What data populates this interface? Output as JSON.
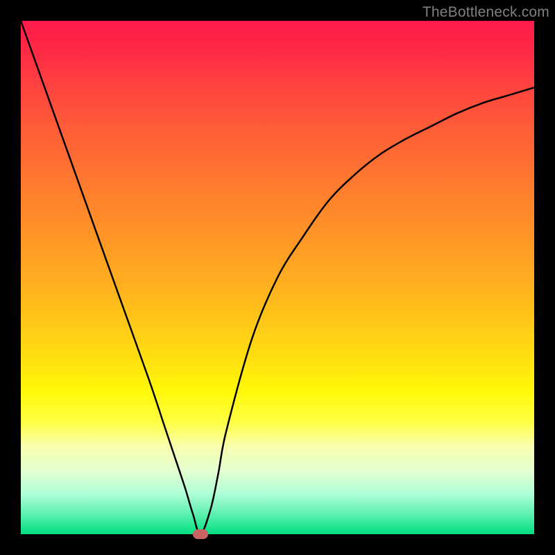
{
  "watermark": "TheBottleneck.com",
  "chart_data": {
    "type": "line",
    "title": "",
    "xlabel": "",
    "ylabel": "",
    "xlim": [
      0,
      100
    ],
    "ylim": [
      0,
      100
    ],
    "series": [
      {
        "name": "curve",
        "x": [
          0,
          5,
          10,
          15,
          20,
          25,
          28,
          30,
          32,
          33.5,
          35,
          37,
          38.5,
          40,
          45,
          50,
          55,
          60,
          65,
          70,
          75,
          80,
          85,
          90,
          95,
          100
        ],
        "y": [
          100,
          86,
          72,
          58,
          44,
          30,
          21,
          15,
          9,
          4,
          0,
          5,
          12,
          20,
          38,
          50,
          58,
          65,
          70,
          74,
          77,
          79.5,
          82,
          84,
          85.5,
          87
        ]
      }
    ],
    "marker": {
      "x": 35,
      "y": 0,
      "color": "#c96464"
    },
    "gradient_stops": [
      {
        "pos": 0,
        "color": "#ff1a4a"
      },
      {
        "pos": 50,
        "color": "#ffab20"
      },
      {
        "pos": 78,
        "color": "#ffff40"
      },
      {
        "pos": 100,
        "color": "#00e080"
      }
    ]
  }
}
